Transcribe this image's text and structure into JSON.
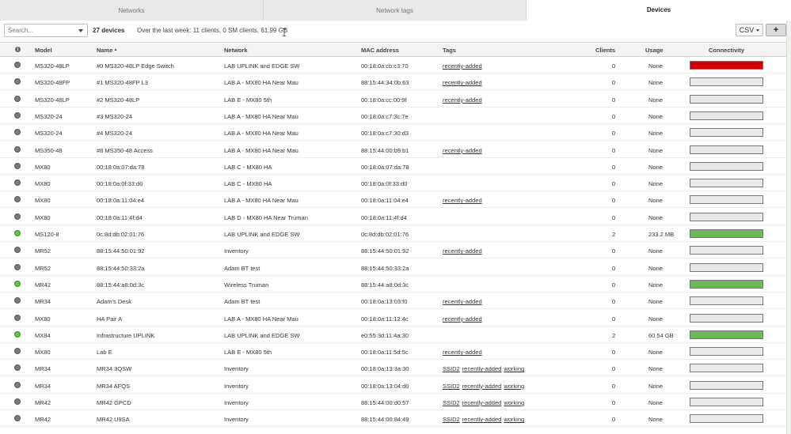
{
  "tabs": [
    {
      "label": "Networks"
    },
    {
      "label": "Network tags"
    },
    {
      "label": "Devices"
    }
  ],
  "toolbar": {
    "search_placeholder": "Search...",
    "count": "27 devices",
    "summary": "Over the last week: 11 clients, 0 SM clients, 61.99 GB",
    "csv_label": "CSV",
    "add_label": "+"
  },
  "columns": {
    "status": "i",
    "model": "Model",
    "name": "Name",
    "network": "Network",
    "mac": "MAC address",
    "tags": "Tags",
    "clients": "Clients",
    "usage": "Usage",
    "connectivity": "Connectivity"
  },
  "colors": {
    "online": "#6cbf4c",
    "offline": "#7a7a7a",
    "alert": "#cc0000",
    "good": "#66bb55",
    "empty": "#e9e9e9"
  },
  "rows": [
    {
      "status": "offline",
      "model": "MS320-48LP",
      "name": "#0 MS320-48LP Edge Switch",
      "network": "LAB UPLINK and EDGE SW",
      "mac": "00:18:0a:cb:c3:70",
      "tags": [
        "recently-added"
      ],
      "clients": "0",
      "usage": "None",
      "connectivity": "alert"
    },
    {
      "status": "offline",
      "model": "MS320-48FP",
      "name": "#1 MS320-48FP L3",
      "network": "LAB A - MX80 HA Near Mau",
      "mac": "88:15:44:34:0b:63",
      "tags": [
        "recently-added"
      ],
      "clients": "0",
      "usage": "None",
      "connectivity": "empty"
    },
    {
      "status": "offline",
      "model": "MS320-48LP",
      "name": "#2 MS320-48LP",
      "network": "LAB E - MX80 5th",
      "mac": "00:18:0a:cc:00:9f",
      "tags": [
        "recently-added"
      ],
      "clients": "0",
      "usage": "None",
      "connectivity": "empty"
    },
    {
      "status": "offline",
      "model": "MS320-24",
      "name": "#3 MS320-24",
      "network": "LAB A - MX80 HA Near Mau",
      "mac": "00:18:0a:c7:3c:7e",
      "tags": [],
      "clients": "0",
      "usage": "None",
      "connectivity": "empty"
    },
    {
      "status": "offline",
      "model": "MS320-24",
      "name": "#4 MS320-24",
      "network": "LAB A - MX80 HA Near Mau",
      "mac": "00:18:0a:c7:30:d3",
      "tags": [],
      "clients": "0",
      "usage": "None",
      "connectivity": "empty"
    },
    {
      "status": "offline",
      "model": "MS350-48",
      "name": "#8 MS350-48 Access",
      "network": "LAB A - MX80 HA Near Mau",
      "mac": "88:15:44:00:b9:b1",
      "tags": [
        "recently-added"
      ],
      "clients": "0",
      "usage": "None",
      "connectivity": "empty"
    },
    {
      "status": "offline",
      "model": "MX80",
      "name": "00:18:0a:07:da:78",
      "network": "LAB C - MX80 HA",
      "mac": "00:18:0a:07:da:78",
      "tags": [],
      "clients": "0",
      "usage": "None",
      "connectivity": "empty"
    },
    {
      "status": "offline",
      "model": "MX80",
      "name": "00:18:0a:0f:33:d0",
      "network": "LAB C - MX80 HA",
      "mac": "00:18:0a:0f:33:d0",
      "tags": [],
      "clients": "0",
      "usage": "None",
      "connectivity": "empty"
    },
    {
      "status": "offline",
      "model": "MX80",
      "name": "00:18:0a:11:04:e4",
      "network": "LAB A - MX80 HA Near Mau",
      "mac": "00:18:0a:11:04:e4",
      "tags": [
        "recently-added"
      ],
      "clients": "0",
      "usage": "None",
      "connectivity": "empty"
    },
    {
      "status": "offline",
      "model": "MX80",
      "name": "00:18:0a:11:4f:d4",
      "network": "LAB D - MX80 HA Near Truman",
      "mac": "00:18:0a:11:4f:d4",
      "tags": [],
      "clients": "0",
      "usage": "None",
      "connectivity": "empty"
    },
    {
      "status": "online",
      "model": "MS120-8",
      "name": "0c:8d:db:02:01:76",
      "network": "LAB UPLINK and EDGE SW",
      "mac": "0c:8d:db:02:01:76",
      "tags": [],
      "clients": "2",
      "usage": "233.2 MB",
      "connectivity": "good"
    },
    {
      "status": "offline",
      "model": "MR52",
      "name": "88:15:44:50:01:92",
      "network": "Inventory",
      "mac": "88:15:44:50:01:92",
      "tags": [
        "recently-added"
      ],
      "clients": "0",
      "usage": "None",
      "connectivity": "empty"
    },
    {
      "status": "offline",
      "model": "MR52",
      "name": "88:15:44:50:33:2a",
      "network": "Adam BT test",
      "mac": "88:15:44:50:33:2a",
      "tags": [],
      "clients": "0",
      "usage": "None",
      "connectivity": "empty"
    },
    {
      "status": "online",
      "model": "MR42",
      "name": "88:15:44:a8:0d:3c",
      "network": "Wireless Truman",
      "mac": "88:15:44:a8:0d:3c",
      "tags": [],
      "clients": "0",
      "usage": "None",
      "connectivity": "good"
    },
    {
      "status": "offline",
      "model": "MR34",
      "name": "Adam's Desk",
      "network": "Adam BT test",
      "mac": "00:18:0a:13:03:f0",
      "tags": [
        "recently-added"
      ],
      "clients": "0",
      "usage": "None",
      "connectivity": "empty"
    },
    {
      "status": "offline",
      "model": "MX80",
      "name": "HA Pair A",
      "network": "LAB A - MX80 HA Near Mau",
      "mac": "00:18:0a:11:12:4c",
      "tags": [
        "recently-added"
      ],
      "clients": "0",
      "usage": "None",
      "connectivity": "empty"
    },
    {
      "status": "online",
      "model": "MX84",
      "name": "Infrastructure UPLINK",
      "network": "LAB UPLINK and EDGE SW",
      "mac": "e0:55:3d:11:4a:30",
      "tags": [],
      "clients": "2",
      "usage": "60.54 GB",
      "connectivity": "good"
    },
    {
      "status": "offline",
      "model": "MX80",
      "name": "Lab E",
      "network": "LAB E - MX80 5th",
      "mac": "00:18:0a:11:5d:5c",
      "tags": [
        "recently-added"
      ],
      "clients": "0",
      "usage": "None",
      "connectivity": "empty"
    },
    {
      "status": "offline",
      "model": "MR34",
      "name": "MR34 3QSW",
      "network": "Inventory",
      "mac": "00:18:0a:13:3a:30",
      "tags": [
        "SSID2",
        "recently-added",
        "working"
      ],
      "clients": "0",
      "usage": "None",
      "connectivity": "empty"
    },
    {
      "status": "offline",
      "model": "MR34",
      "name": "MR34 AFQS",
      "network": "Inventory",
      "mac": "00:18:0a:13:04:d0",
      "tags": [
        "SSID2",
        "recently-added",
        "working"
      ],
      "clients": "0",
      "usage": "None",
      "connectivity": "empty"
    },
    {
      "status": "offline",
      "model": "MR42",
      "name": "MR42 GPCD",
      "network": "Inventory",
      "mac": "88:15:44:00:d0:57",
      "tags": [
        "SSID2",
        "recently-added",
        "working"
      ],
      "clients": "0",
      "usage": "None",
      "connectivity": "empty"
    },
    {
      "status": "offline",
      "model": "MR42",
      "name": "MR42 U9SA",
      "network": "Inventory",
      "mac": "88:15:44:00:84:49",
      "tags": [
        "SSID2",
        "recently-added",
        "working"
      ],
      "clients": "0",
      "usage": "None",
      "connectivity": "empty"
    }
  ]
}
